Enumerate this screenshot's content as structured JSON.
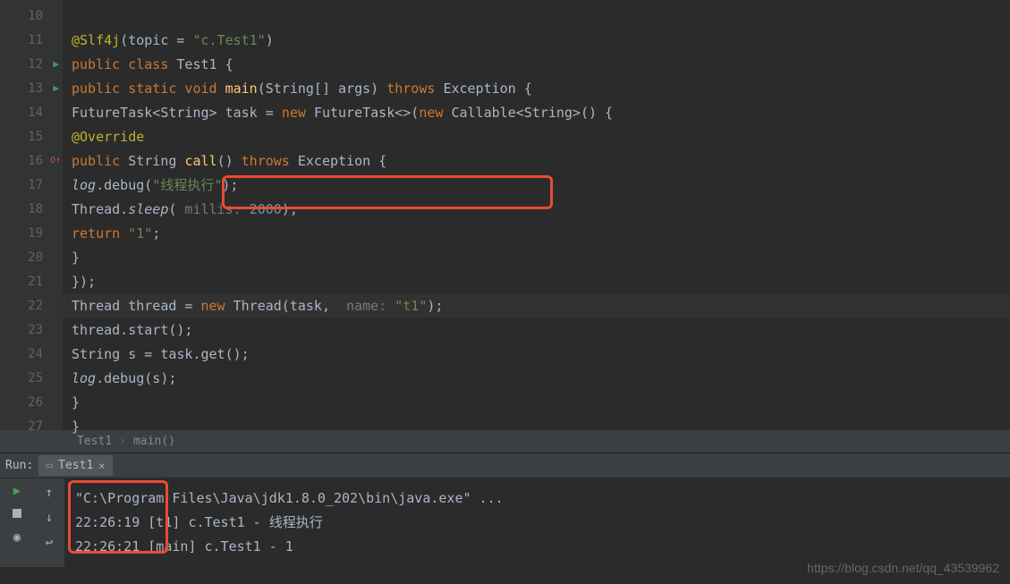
{
  "gutter": {
    "lines": [
      "10",
      "11",
      "12",
      "13",
      "14",
      "15",
      "16",
      "17",
      "18",
      "19",
      "20",
      "21",
      "22",
      "23",
      "24",
      "25",
      "26",
      "27"
    ]
  },
  "code": {
    "l11_ann": "@Slf4j",
    "l11_rest1": "(topic = ",
    "l11_str": "\"c.Test1\"",
    "l11_rest2": ")",
    "l12_kw1": "public class ",
    "l12_name": "Test1 {",
    "l13_kw": "public static void ",
    "l13_m": "main",
    "l13_rest1": "(String[] args) ",
    "l13_kw2": "throws ",
    "l13_rest2": "Exception {",
    "l14_p1": "FutureTask<String> task = ",
    "l14_kw": "new ",
    "l14_p2": "FutureTask<>(",
    "l14_kw2": "new ",
    "l14_p3": "Callable<String>() {",
    "l15_ann": "@Override",
    "l16_kw": "public ",
    "l16_p1": "String ",
    "l16_m": "call",
    "l16_p2": "() ",
    "l16_kw2": "throws ",
    "l16_p3": "Exception {",
    "l17_f": "log",
    "l17_p1": ".debug(",
    "l17_str": "\"线程执行\"",
    "l17_p2": ");",
    "l18_p1": "Thread.",
    "l18_m": "sleep",
    "l18_p2": "(",
    "l18_hint": " millis: ",
    "l18_num": "2000",
    "l18_p3": ");",
    "l19_kw": "return ",
    "l19_str": "\"1\"",
    "l19_p": ";",
    "l20": "}",
    "l21": "});",
    "l22_p1": "Thread thread = ",
    "l22_kw": "new ",
    "l22_p2": "Thread(task, ",
    "l22_hint": " name: ",
    "l22_str": "\"t1\"",
    "l22_p3": ");",
    "l23": "thread.start();",
    "l24": "String s = task.get();",
    "l25_f": "log",
    "l25_p1": ".debug(s);",
    "l26": "}",
    "l27": "}"
  },
  "breadcrumb": {
    "item1": "Test1",
    "item2": "main()"
  },
  "run": {
    "label": "Run:",
    "tab": "Test1",
    "console": {
      "line1": "\"C:\\Program Files\\Java\\jdk1.8.0_202\\bin\\java.exe\" ...",
      "line2_time": "22:26:19",
      "line2_rest": " [t1] c.Test1 - 线程执行",
      "line3_time": "22:26:21",
      "line3_rest": " [main] c.Test1 - 1"
    }
  },
  "watermark": "https://blog.csdn.net/qq_43539962"
}
